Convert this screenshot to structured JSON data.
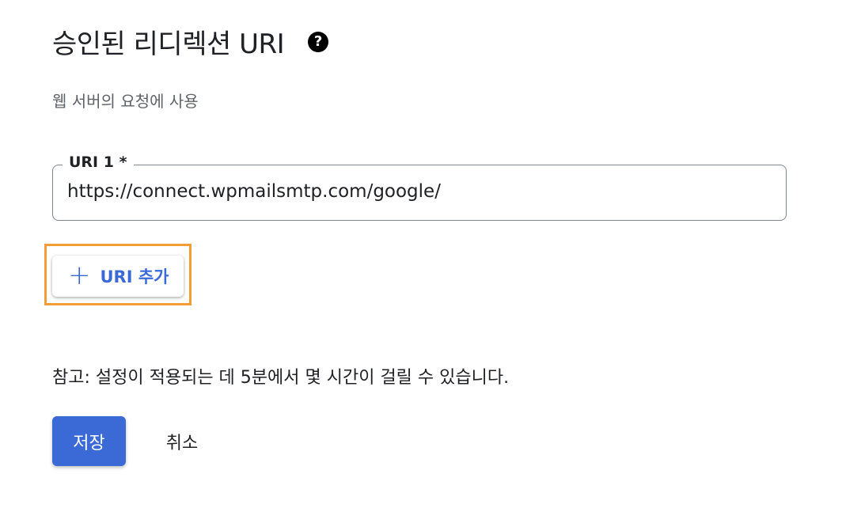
{
  "header": {
    "title": "승인된 리디렉션 URI",
    "help_icon": "help-circle-icon",
    "help_glyph": "?"
  },
  "subtitle": "웹 서버의 요청에 사용",
  "uri_field": {
    "label": "URI 1 *",
    "value": "https://connect.wpmailsmtp.com/google/"
  },
  "add_button": {
    "icon": "plus-icon",
    "icon_glyph": "+",
    "label": "URI 추가"
  },
  "note": "참고: 설정이 적용되는 데 5분에서 몇 시간이 걸릴 수 있습니다.",
  "actions": {
    "save_label": "저장",
    "cancel_label": "취소"
  },
  "colors": {
    "accent": "#3b6ad6",
    "highlight": "#f29d38",
    "text": "#202124",
    "muted": "#5f6368"
  }
}
